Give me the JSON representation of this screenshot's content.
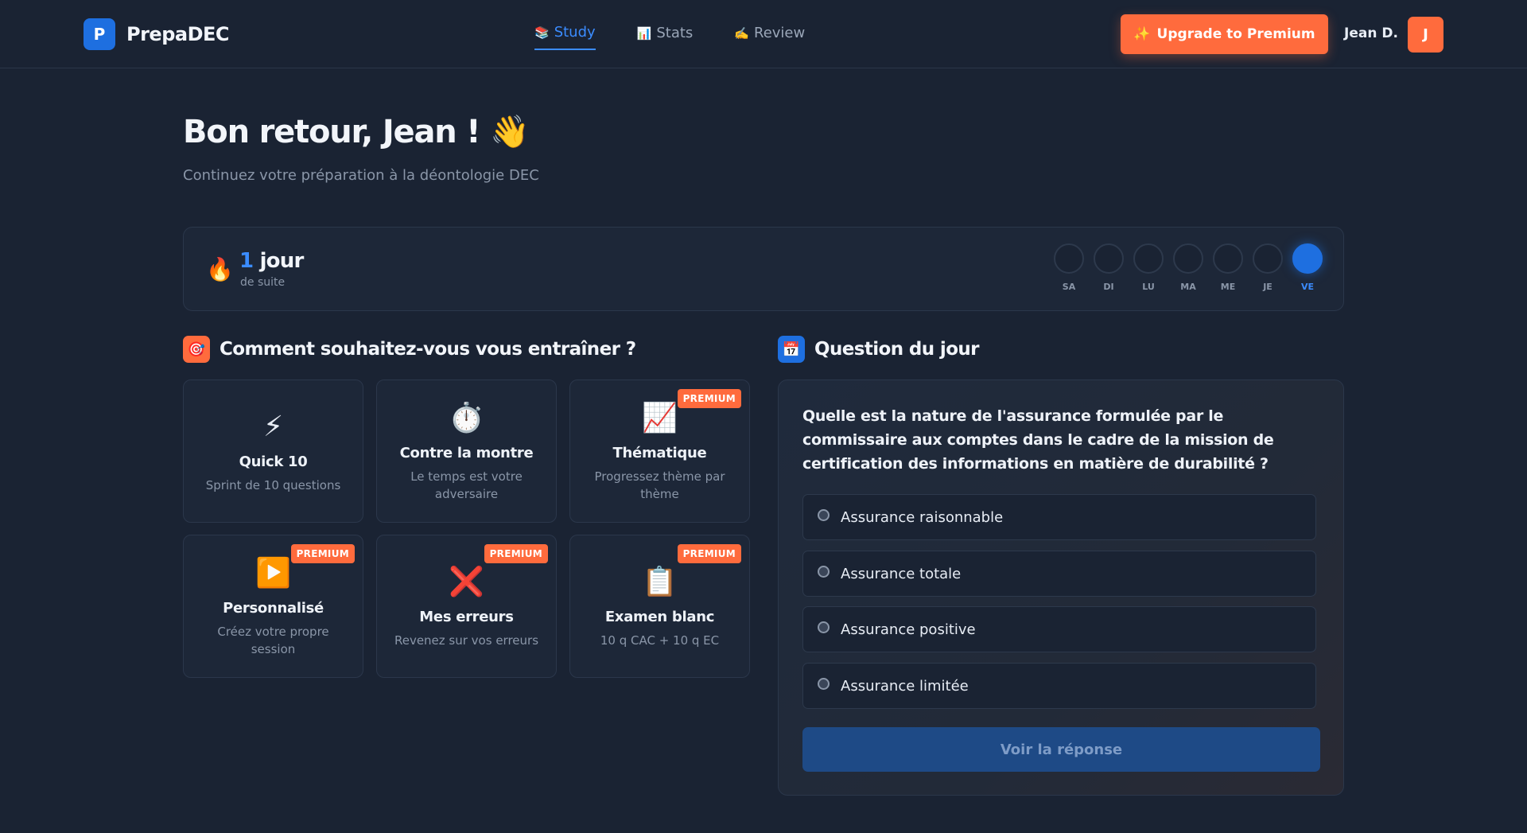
{
  "header": {
    "brand_letter": "P",
    "brand_name": "PrepaDEC",
    "nav": [
      {
        "icon": "📚",
        "label": "Study"
      },
      {
        "icon": "📊",
        "label": "Stats"
      },
      {
        "icon": "✍️",
        "label": "Review"
      }
    ],
    "upgrade_icon": "✨",
    "upgrade_label": "Upgrade to Premium",
    "user_name": "Jean D.",
    "user_initial": "J"
  },
  "welcome": {
    "title": "Bon retour, Jean ! 👋",
    "subtitle": "Continuez votre préparation à la déontologie DEC"
  },
  "streak": {
    "icon": "🔥",
    "count": "1",
    "unit": "jour",
    "sub": "de suite",
    "days": [
      "SA",
      "DI",
      "LU",
      "MA",
      "ME",
      "JE",
      "VE"
    ]
  },
  "training": {
    "icon": "🎯",
    "title": "Comment souhaitez-vous vous entraîner ?",
    "modes": [
      {
        "icon": "⚡",
        "title": "Quick 10",
        "desc": "Sprint de 10 questions",
        "badge": ""
      },
      {
        "icon": "⏱️",
        "title": "Contre la montre",
        "desc": "Le temps est votre adversaire",
        "badge": ""
      },
      {
        "icon": "📈",
        "title": "Thématique",
        "desc": "Progressez thème par thème",
        "badge": "PREMIUM"
      },
      {
        "icon": "▶️",
        "title": "Personnalisé",
        "desc": "Créez votre propre session",
        "badge": "PREMIUM"
      },
      {
        "icon": "❌",
        "title": "Mes erreurs",
        "desc": "Revenez sur vos erreurs",
        "badge": "PREMIUM"
      },
      {
        "icon": "📋",
        "title": "Examen blanc",
        "desc": "10 q CAC + 10 q EC",
        "badge": "PREMIUM"
      }
    ]
  },
  "question": {
    "icon": "📅",
    "title": "Question du jour",
    "text": "Quelle est la nature de l'assurance formulée par le commissaire aux comptes dans le cadre de la mission de certification des informations en matière de durabilité ?",
    "options": [
      "Assurance raisonnable",
      "Assurance totale",
      "Assurance positive",
      "Assurance limitée"
    ],
    "reveal_label": "Voir la réponse"
  },
  "colors": {
    "accent": "#1e6fe0",
    "premium": "#ff6b3d",
    "background": "#1a2333"
  }
}
